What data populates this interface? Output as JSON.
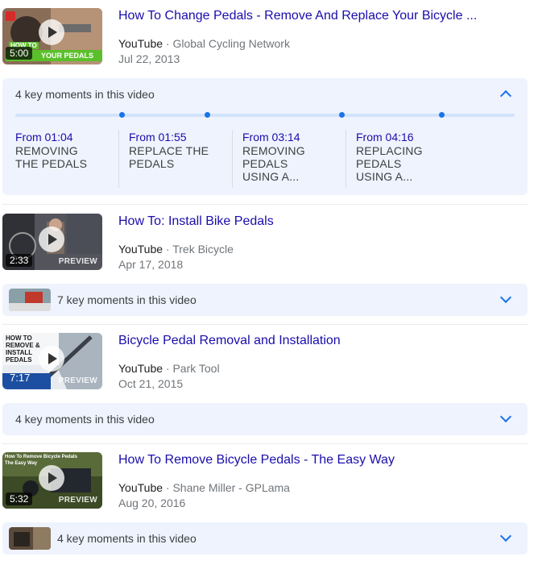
{
  "results": [
    {
      "title": "How To Change Pedals - Remove And Replace Your Bicycle ...",
      "site": "YouTube",
      "channel": "Global Cycling Network",
      "date": "Jul 22, 2013",
      "duration": "5:00",
      "thumb_text": "YOUR PEDALS",
      "thumb_text_small": "HOW TO",
      "moments": {
        "label": "4 key moments in this video",
        "expanded": true,
        "items": [
          {
            "time": "From 01:04",
            "label": "REMOVING THE PEDALS"
          },
          {
            "time": "From 01:55",
            "label": "REPLACE THE PEDALS"
          },
          {
            "time": "From 03:14",
            "label": "REMOVING PEDALS USING A..."
          },
          {
            "time": "From 04:16",
            "label": "REPLACING PEDALS USING A..."
          }
        ]
      }
    },
    {
      "title": "How To: Install Bike Pedals",
      "site": "YouTube",
      "channel": "Trek Bicycle",
      "date": "Apr 17, 2018",
      "duration": "2:33",
      "preview": "PREVIEW",
      "moments": {
        "label": "7 key moments in this video",
        "expanded": false
      }
    },
    {
      "title": "Bicycle Pedal Removal and Installation",
      "site": "YouTube",
      "channel": "Park Tool",
      "date": "Oct 21, 2015",
      "duration": "7:17",
      "preview": "PREVIEW",
      "thumb_text": "HOW TO REMOVE & INSTALL PEDALS",
      "moments": {
        "label": "4 key moments in this video",
        "expanded": false
      }
    },
    {
      "title": "How To Remove Bicycle Pedals - The Easy Way",
      "site": "YouTube",
      "channel": "Shane Miller - GPLama",
      "date": "Aug 20, 2016",
      "duration": "5:32",
      "preview": "PREVIEW",
      "thumb_text": "How To Remove Bicycle Pedals The Easy Way",
      "moments": {
        "label": "4 key moments in this video",
        "expanded": false
      }
    }
  ],
  "separator": "·",
  "colors": {
    "link": "#1a0dab",
    "accent": "#1a73e8",
    "moments_bg": "#eef3fd"
  }
}
